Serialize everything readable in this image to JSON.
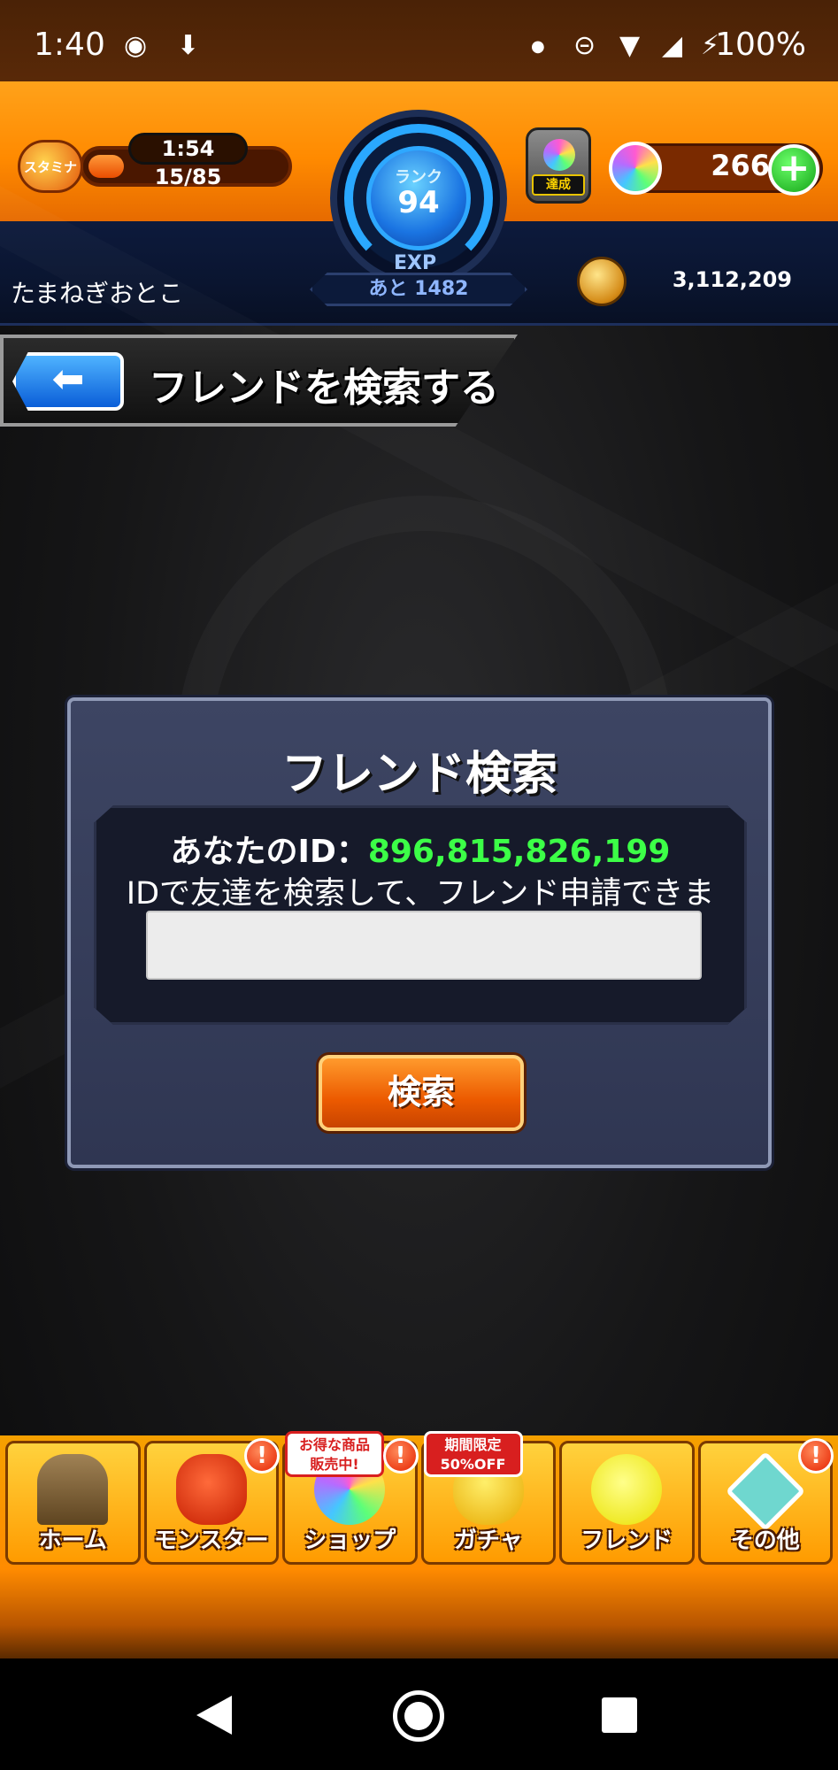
{
  "status_bar": {
    "time": "1:40",
    "battery": "100%",
    "icons": [
      "location-icon",
      "download-icon",
      "dot-icon",
      "dnd-icon",
      "wifi-icon",
      "cell-signal-icon",
      "battery-charging-icon"
    ]
  },
  "hud": {
    "stamina_label": "スタミナ",
    "stamina_timer": "1:54",
    "stamina_value": "15/85",
    "stamina_fraction": 0.18,
    "rank_label": "ランク",
    "rank_value": "94",
    "exp_label": "EXP",
    "exp_remaining": "あと 1482",
    "achieve_label": "達成",
    "orb_count": "266",
    "plus_label": "+",
    "player_name": "たまねぎおとこ",
    "gold": "3,112,209"
  },
  "page": {
    "back_icon": "back-arrow-icon",
    "title": "フレンドを検索する"
  },
  "dialog": {
    "title": "フレンド検索",
    "your_id_label": "あなたのID：",
    "your_id_value": "896,815,826,199",
    "description": "IDで友達を検索して、フレンド申請できます！",
    "input_value": "",
    "search_button": "検索"
  },
  "bottom_nav": {
    "items": [
      {
        "label": "ホーム",
        "icon": "home-gate-icon",
        "alert": ""
      },
      {
        "label": "モンスター",
        "icon": "monster-icon",
        "alert": "!"
      },
      {
        "label": "ショップ",
        "icon": "rainbow-orb-icon",
        "alert": "!",
        "promo": "お得な商品\n販売中!"
      },
      {
        "label": "ガチャ",
        "icon": "egg-icon",
        "alert": "",
        "promo": "期間限定\n50%OFF"
      },
      {
        "label": "フレンド",
        "icon": "friends-icon",
        "alert": ""
      },
      {
        "label": "その他",
        "icon": "other-icon",
        "alert": "!"
      }
    ]
  },
  "colors": {
    "hud_orange": "#ff8a00",
    "hud_navy": "#0a1530",
    "id_green": "#3cff47",
    "button_orange": "#ec5a00"
  }
}
